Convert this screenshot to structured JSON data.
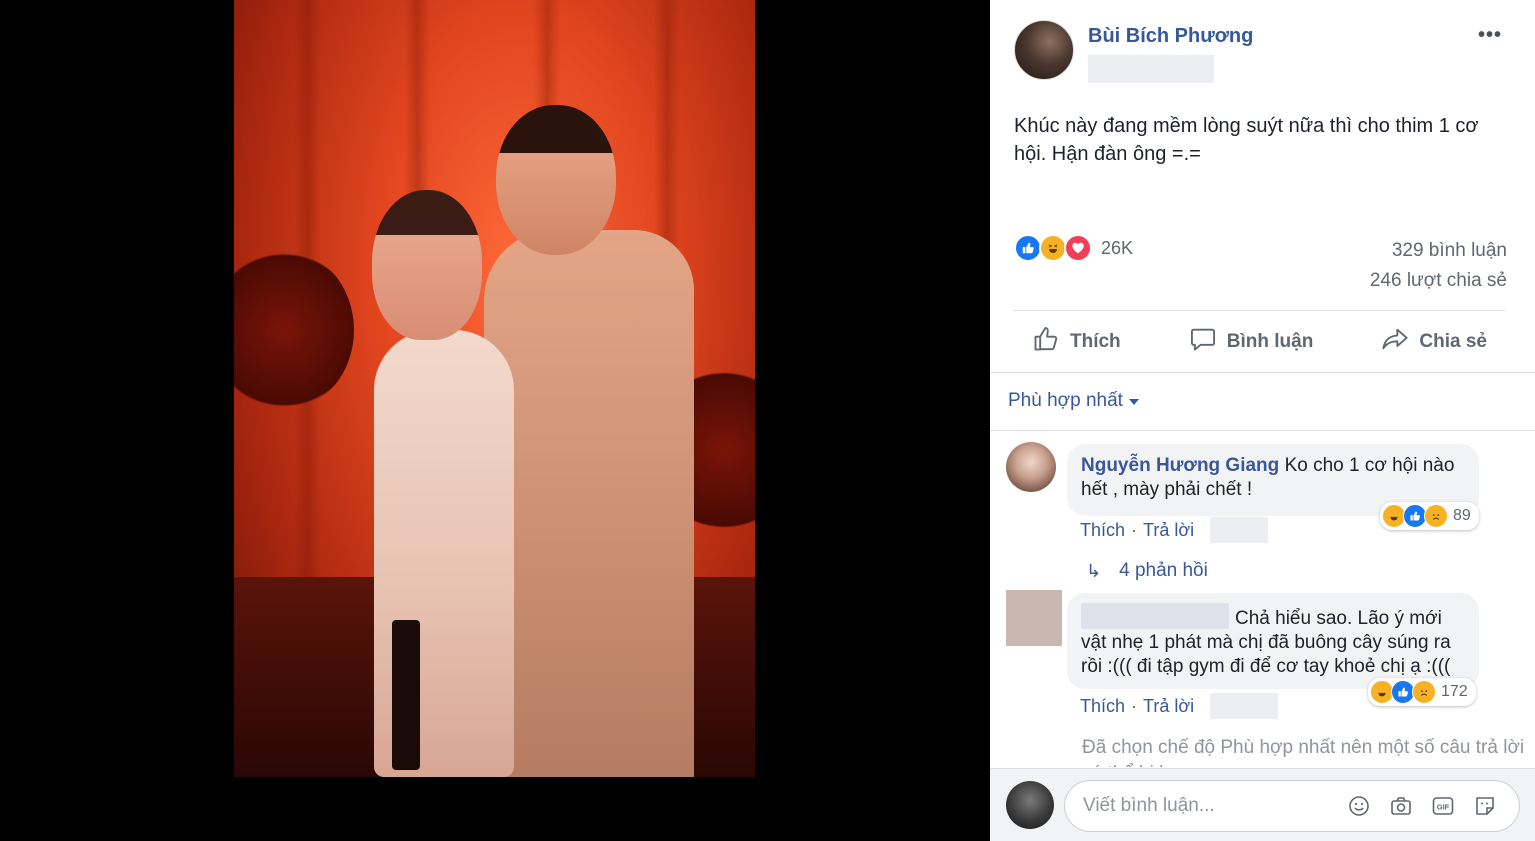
{
  "post": {
    "author": "Bùi Bích Phương",
    "more_label": "•••",
    "text": "Khúc này đang mềm lòng suýt nữa thì cho thim 1 cơ hội. Hận đàn ông =.=",
    "reaction_count": "26K",
    "comment_count": "329 bình luận",
    "share_count": "246 lượt chia sẻ",
    "reaction_types": [
      "like-icon",
      "haha-icon",
      "love-icon"
    ]
  },
  "actions": {
    "like": "Thích",
    "comment": "Bình luận",
    "share": "Chia sẻ"
  },
  "sort": {
    "label": "Phù hợp nhất"
  },
  "comments": [
    {
      "author": "Nguyễn Hương Giang",
      "text": "Ko cho 1 cơ hội nào hết , mày phải chết !",
      "reaction_count": "89",
      "reactions": [
        "haha-icon",
        "like-icon",
        "sad-icon"
      ],
      "like_label": "Thích",
      "reply_label": "Trả lời",
      "replies_label": "4 phản hồi"
    },
    {
      "author": "",
      "text": "Chả hiểu sao. Lão ý mới vật nhẹ 1 phát mà chị đã buông cây súng ra rồi :((( đi tập gym đi để cơ tay khoẻ chị ạ :(((",
      "reaction_count": "172",
      "reactions": [
        "haha-icon",
        "like-icon",
        "sad-icon"
      ],
      "like_label": "Thích",
      "reply_label": "Trả lời"
    }
  ],
  "relevance_note": "Đã chọn chế độ Phù hợp nhất nên một số câu trả lời có thể bị lọc ra.",
  "composer": {
    "placeholder": "Viết bình luận...",
    "icons": [
      "emoji-icon",
      "camera-icon",
      "gif-icon",
      "sticker-icon"
    ]
  },
  "colors": {
    "link_blue": "#385898",
    "author_blue": "#365899",
    "secondary_text": "#606770",
    "bubble_bg": "#f2f3f5"
  }
}
